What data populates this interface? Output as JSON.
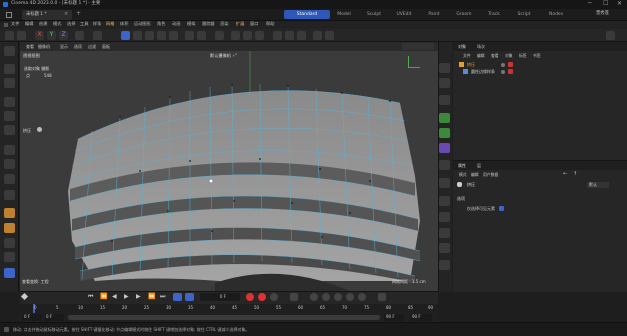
{
  "window": {
    "title": "Cinema 4D 2023.0.0 - [未标题 1 *] - 主要",
    "tab_label": "未标题 1 *",
    "user": "曾秀莲"
  },
  "layouts": [
    "Standard",
    "Model",
    "Sculpt",
    "UVEdit",
    "Paint",
    "Groom",
    "Track",
    "Script",
    "Nodes"
  ],
  "menu": [
    "文件",
    "编辑",
    "创建",
    "模式",
    "选择",
    "工具",
    "样条",
    "网格",
    "体积",
    "运动图形",
    "角色",
    "动画",
    "模拟",
    "跟踪器",
    "渲染",
    "扩展",
    "窗口",
    "帮助"
  ],
  "axis_toolbar": {
    "x": "X",
    "y": "Y",
    "z": "Z"
  },
  "viewport": {
    "menu": [
      "查看",
      "摄像机",
      "显示",
      "选项",
      "过滤",
      "面板"
    ],
    "label": "透视视图",
    "camera": "默认摄像机 ∘°",
    "hud_title": "选取对象 摄影",
    "hud_count_label": "点",
    "hud_count_value": "548",
    "hud_name": "挤压",
    "speed_label": "查看变换: 工程",
    "grid_label": "网格间距 : 1.5 cm"
  },
  "objects": {
    "tabs": [
      "对象",
      "场次"
    ],
    "menu": [
      "文件",
      "编辑",
      "查看",
      "对象",
      "标签",
      "书签"
    ],
    "items": [
      {
        "name": "挤压",
        "color": "#e0a030"
      },
      {
        "name": "圆柱边缘样条",
        "color": "#c8c8c8"
      }
    ]
  },
  "attributes": {
    "tabs": [
      "属性",
      "层"
    ],
    "menu": [
      "模式",
      "编辑",
      "用户数据"
    ],
    "object_name": "挤压",
    "dropdown": "默认",
    "section": "选项",
    "checkbox_label": "仅选择可见元素"
  },
  "timeline": {
    "ticks": [
      "0",
      "5",
      "10",
      "15",
      "20",
      "25",
      "30",
      "35",
      "40",
      "45",
      "50",
      "55",
      "60",
      "65",
      "70",
      "75",
      "80",
      "85",
      "90"
    ],
    "current_frame": "0 F",
    "start": "0 F",
    "start2": "0 F",
    "end": "90 F",
    "end2": "90 F"
  },
  "status": "移动: 点击并拖动鼠标移动元素。按住 SHIFT 键量化移动; 节点编辑模式时按住 SHIFT 键增加选择对象; 按住 CTRL 键减少选择对象。"
}
